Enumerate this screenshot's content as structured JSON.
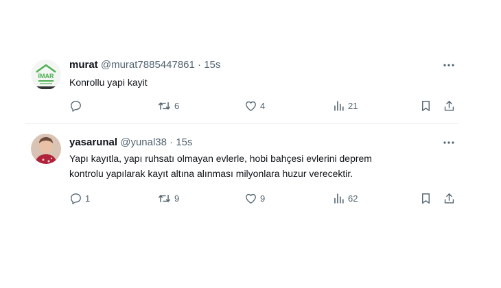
{
  "tweets": [
    {
      "name": "murat",
      "handle": "@murat7885447861",
      "separator": "·",
      "time": "15s",
      "avatar": {
        "kind": "logo",
        "text": "İMAR"
      },
      "text": "Konrollu yapi kayit",
      "replies": "",
      "retweets": "6",
      "likes": "4",
      "views": "21"
    },
    {
      "name": "yasarunal",
      "handle": "@yunal38",
      "separator": "·",
      "time": "15s",
      "avatar": {
        "kind": "photo"
      },
      "text_lines": [
        "Yapı kayıtla, yapı ruhsatı olmayan evlerle, hobi bahçesi evlerini  deprem",
        "kontrolu yapılarak kayıt altına alınması milyonlara huzur verecektir."
      ],
      "replies": "1",
      "retweets": "9",
      "likes": "9",
      "views": "62"
    }
  ],
  "icons": {
    "reply": "reply-icon",
    "retweet": "retweet-icon",
    "like": "heart-icon",
    "views": "views-icon",
    "bookmark": "bookmark-icon",
    "share": "share-icon",
    "more": "more-icon"
  },
  "colors": {
    "text": "#0f1419",
    "secondary": "#536471",
    "divider": "#e6ecf0",
    "logo_green": "#4caf50"
  }
}
